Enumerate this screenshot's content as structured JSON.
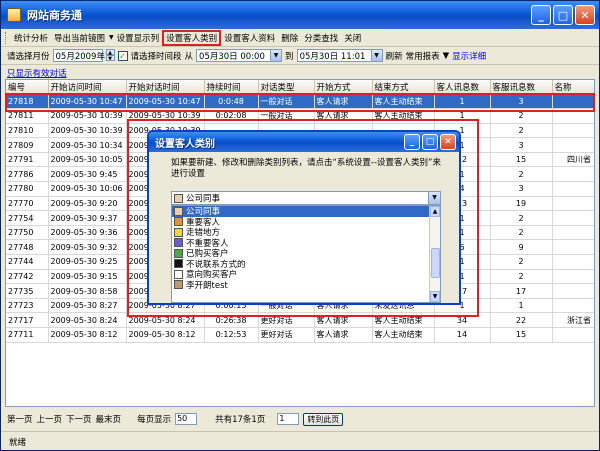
{
  "window": {
    "title": "网站商务通"
  },
  "toolbar": {
    "items": [
      "统计分析",
      "导出当前镜图",
      "设置显示列",
      "设置客人类别",
      "设置客人资料",
      "删除",
      "分类查找",
      "关闭"
    ]
  },
  "filter": {
    "label_month": "请选择月份",
    "month_value": "05月2009年",
    "label_range": "请选择时间段",
    "from_prefix": "从",
    "from_value": "05月30日 00:00",
    "to_prefix": "到",
    "to_value": "05月30日 11:01",
    "refresh": "刷新",
    "reports": "常用报表",
    "show_detail": "显示详细"
  },
  "grid": {
    "label": "只显示有效对话",
    "columns": [
      "编号",
      "开始访问时间",
      "开始对话时间",
      "持续时间",
      "对话类型",
      "开始方式",
      "结束方式",
      "客人讯息数",
      "客服讯息数",
      "名称"
    ],
    "rows": [
      [
        "27818",
        "2009-05-30 10:47",
        "2009-05-30 10:47",
        "0:0:48",
        "一般对话",
        "客人请求",
        "客人主动结束",
        "1",
        "3",
        ""
      ],
      [
        "27811",
        "2009-05-30 10:39",
        "2009-05-30 10:39",
        "0:02:08",
        "一般对话",
        "客人请求",
        "客人主动结束",
        "1",
        "2",
        ""
      ],
      [
        "27810",
        "2009-05-30 10:39",
        "2009-05-30 10:39",
        "",
        "",
        "",
        "",
        "1",
        "2",
        ""
      ],
      [
        "27809",
        "2009-05-30 10:34",
        "2009-05-30 10:34",
        "",
        "",
        "",
        "",
        "1",
        "3",
        ""
      ],
      [
        "27791",
        "2009-05-30 10:05",
        "2009-05-30 10:05",
        "",
        "",
        "",
        "",
        "12",
        "15",
        "四川省"
      ],
      [
        "27786",
        "2009-05-30 9:45",
        "2009-05-30 9:45",
        "",
        "",
        "",
        "",
        "1",
        "2",
        ""
      ],
      [
        "27780",
        "2009-05-30 10:06",
        "2009-05-30 10:06",
        "",
        "",
        "",
        "",
        "4",
        "3",
        ""
      ],
      [
        "27770",
        "2009-05-30 9:20",
        "2009-05-30 9:20",
        "",
        "",
        "",
        "",
        "13",
        "19",
        ""
      ],
      [
        "27754",
        "2009-05-30 9:37",
        "2009-05-30 9:37",
        "",
        "",
        "",
        "",
        "1",
        "2",
        ""
      ],
      [
        "27750",
        "2009-05-30 9:36",
        "2009-05-30 9:36",
        "",
        "",
        "",
        "",
        "1",
        "2",
        ""
      ],
      [
        "27748",
        "2009-05-30 9:32",
        "2009-05-30 9:32",
        "",
        "",
        "",
        "",
        "6",
        "9",
        ""
      ],
      [
        "27744",
        "2009-05-30 9:25",
        "2009-05-30 9:25",
        "",
        "",
        "",
        "",
        "1",
        "2",
        ""
      ],
      [
        "27742",
        "2009-05-30 9:15",
        "2009-05-30 9:15",
        "0:2:28",
        "一般对话",
        "客人请求",
        "客人主动结束",
        "1",
        "2",
        ""
      ],
      [
        "27735",
        "2009-05-30 8:58",
        "2009-05-30 8:58",
        "0:11:39",
        "更好对话",
        "客人请求",
        "客人主动结束",
        "17",
        "17",
        ""
      ],
      [
        "27723",
        "2009-05-30 8:27",
        "2009-05-30 8:27",
        "0:00:13",
        "一般对话",
        "客人请求",
        "未发送讯息",
        "1",
        "1",
        ""
      ],
      [
        "27717",
        "2009-05-30 8:24",
        "2009-05-30 8:24",
        "0:26:38",
        "更好对话",
        "客人请求",
        "客人主动结束",
        "34",
        "22",
        "浙江省"
      ],
      [
        "27711",
        "2009-05-30 8:12",
        "2009-05-30 8:12",
        "0:12:53",
        "更好对话",
        "客人请求",
        "客人主动结束",
        "14",
        "15",
        ""
      ]
    ]
  },
  "pager": {
    "first": "第一页",
    "prev": "上一页",
    "next": "下一页",
    "last": "最末页",
    "per_page_label": "每页显示",
    "per_page": "50",
    "total": "共有17条1页",
    "page": "1",
    "goto": "转到此页"
  },
  "status": {
    "text": "就绪"
  },
  "dialog": {
    "title": "设置客人类别",
    "message": "如果要新建、修改和删除类别列表，请点击“系统设置--设置客人类别”来进行设置",
    "combo_value": "公司同事",
    "categories": [
      {
        "label": "公司同事",
        "color": "#e8d0a8"
      },
      {
        "label": "重要客人",
        "color": "#e8913a"
      },
      {
        "label": "走错地方",
        "color": "#f2d73c"
      },
      {
        "label": "不重要客人",
        "color": "#6b5fd0"
      },
      {
        "label": "已购买客户",
        "color": "#49a84a"
      },
      {
        "label": "不说联系方式的",
        "color": "#111111"
      },
      {
        "label": "意向购买客户",
        "color": "#ffffff"
      },
      {
        "label": "李开朗test",
        "color": "#bd9a6a"
      }
    ],
    "selected_index": 0
  },
  "colors": {
    "titlebar": "#0a58d8",
    "selection": "#316ac5",
    "annotation": "#e02020"
  }
}
